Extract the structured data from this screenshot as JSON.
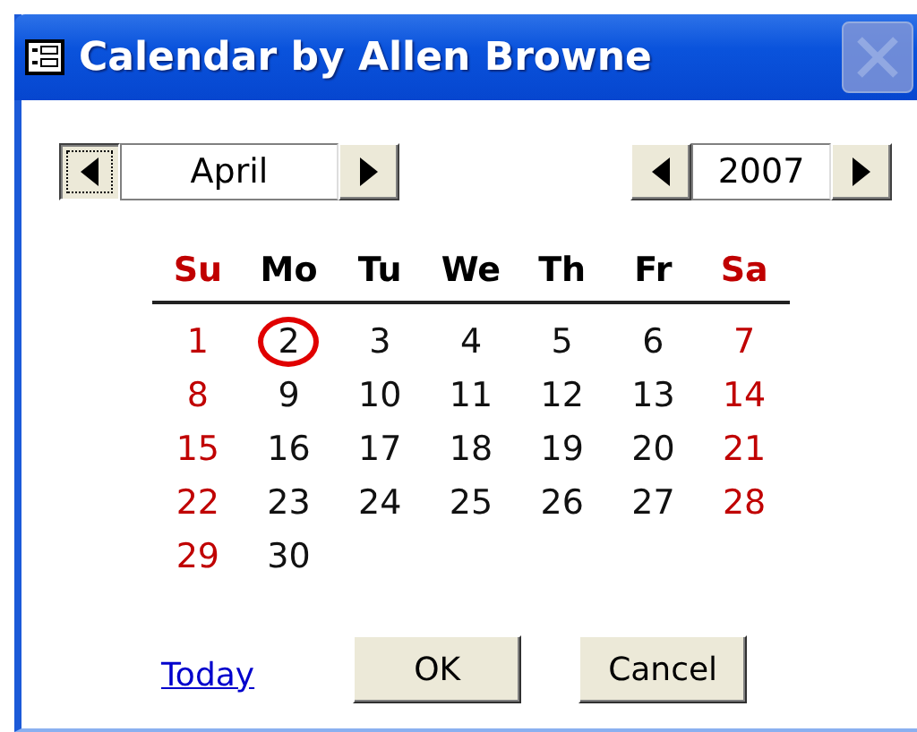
{
  "window": {
    "title": "Calendar by Allen Browne",
    "close_disabled": true
  },
  "month_picker": {
    "value": "April",
    "prev_focused": true
  },
  "year_picker": {
    "value": "2007"
  },
  "weekdays": [
    {
      "label": "Su",
      "weekend": true
    },
    {
      "label": "Mo",
      "weekend": false
    },
    {
      "label": "Tu",
      "weekend": false
    },
    {
      "label": "We",
      "weekend": false
    },
    {
      "label": "Th",
      "weekend": false
    },
    {
      "label": "Fr",
      "weekend": false
    },
    {
      "label": "Sa",
      "weekend": true
    }
  ],
  "weeks": [
    [
      {
        "day": "1",
        "weekend": true,
        "selected": false
      },
      {
        "day": "2",
        "weekend": false,
        "selected": true
      },
      {
        "day": "3",
        "weekend": false,
        "selected": false
      },
      {
        "day": "4",
        "weekend": false,
        "selected": false
      },
      {
        "day": "5",
        "weekend": false,
        "selected": false
      },
      {
        "day": "6",
        "weekend": false,
        "selected": false
      },
      {
        "day": "7",
        "weekend": true,
        "selected": false
      }
    ],
    [
      {
        "day": "8",
        "weekend": true,
        "selected": false
      },
      {
        "day": "9",
        "weekend": false,
        "selected": false
      },
      {
        "day": "10",
        "weekend": false,
        "selected": false
      },
      {
        "day": "11",
        "weekend": false,
        "selected": false
      },
      {
        "day": "12",
        "weekend": false,
        "selected": false
      },
      {
        "day": "13",
        "weekend": false,
        "selected": false
      },
      {
        "day": "14",
        "weekend": true,
        "selected": false
      }
    ],
    [
      {
        "day": "15",
        "weekend": true,
        "selected": false
      },
      {
        "day": "16",
        "weekend": false,
        "selected": false
      },
      {
        "day": "17",
        "weekend": false,
        "selected": false
      },
      {
        "day": "18",
        "weekend": false,
        "selected": false
      },
      {
        "day": "19",
        "weekend": false,
        "selected": false
      },
      {
        "day": "20",
        "weekend": false,
        "selected": false
      },
      {
        "day": "21",
        "weekend": true,
        "selected": false
      }
    ],
    [
      {
        "day": "22",
        "weekend": true,
        "selected": false
      },
      {
        "day": "23",
        "weekend": false,
        "selected": false
      },
      {
        "day": "24",
        "weekend": false,
        "selected": false
      },
      {
        "day": "25",
        "weekend": false,
        "selected": false
      },
      {
        "day": "26",
        "weekend": false,
        "selected": false
      },
      {
        "day": "27",
        "weekend": false,
        "selected": false
      },
      {
        "day": "28",
        "weekend": true,
        "selected": false
      }
    ],
    [
      {
        "day": "29",
        "weekend": true,
        "selected": false
      },
      {
        "day": "30",
        "weekend": false,
        "selected": false
      }
    ]
  ],
  "footer": {
    "link": "Today",
    "buttons": [
      "OK",
      "Cancel"
    ]
  }
}
